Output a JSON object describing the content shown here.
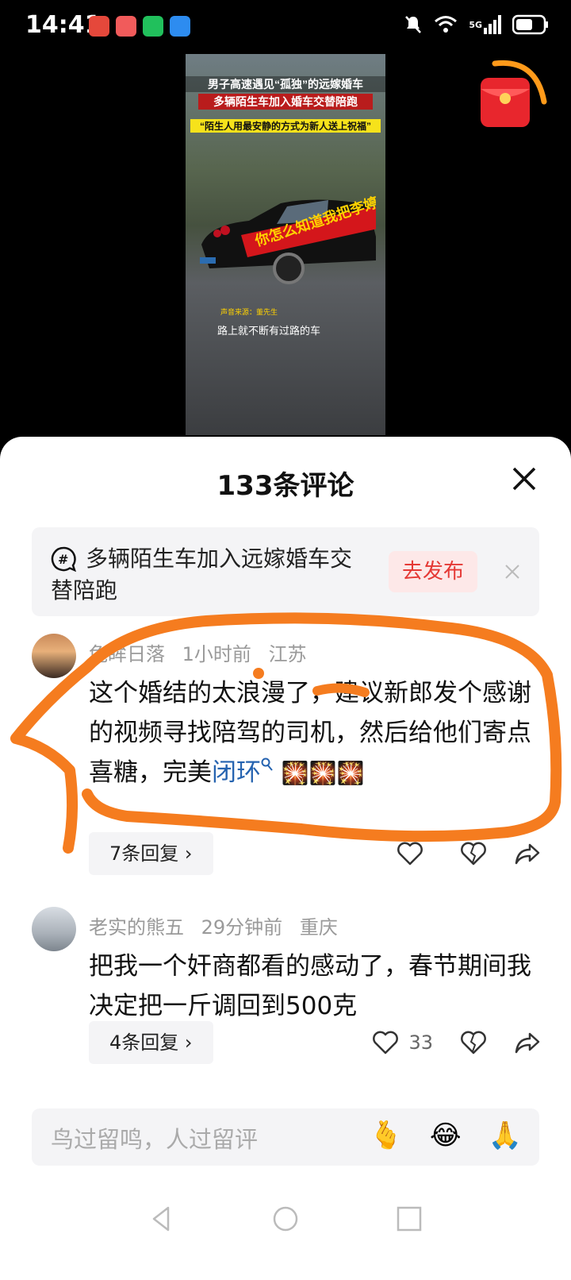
{
  "status_bar": {
    "time": "14:41",
    "network": "5G"
  },
  "video": {
    "caption_line1": "男子高速遇见“孤独”的远嫁婚车",
    "caption_line2": "多辆陌生车加入婚车交替陪跑",
    "caption_line3": "“陌生人用最安静的方式为新人送上祝福”",
    "banner_text": "你怎么知道我把李婷",
    "audio_source": "声音来源：董先生",
    "subtitle": "路上就不断有过路的车"
  },
  "comments_panel": {
    "title": "133条评论",
    "topic": {
      "text": "多辆陌生车加入远嫁婚车交替陪跑",
      "publish_label": "去发布"
    },
    "comments": [
      {
        "user": "兔眸日落",
        "time": "1小时前",
        "location": "江苏",
        "text_before_link": "这个婚结的太浪漫了，建议新郎发个感谢的视频寻找陪驾的司机，然后给他们寄点喜糖，完美",
        "link_text": "闭环",
        "emojis": "🎇🎇🎇",
        "replies_label": "7条回复 ›",
        "like_count": ""
      },
      {
        "user": "老实的熊五",
        "time": "29分钟前",
        "location": "重庆",
        "text": "把我一个奸商都看的感动了，春节期间我决定把一斤调回到500克",
        "replies_label": "4条回复 ›",
        "like_count": "33"
      }
    ],
    "input_placeholder": "鸟过留鸣，人过留评",
    "input_emojis": [
      "🫰",
      "😂",
      "🙏"
    ]
  }
}
